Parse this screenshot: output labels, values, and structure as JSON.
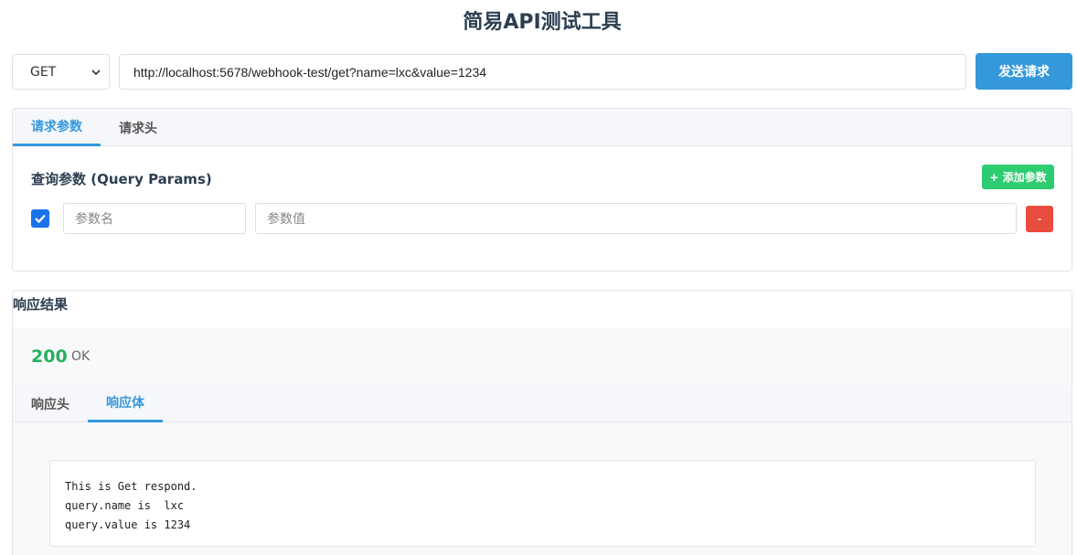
{
  "title": "简易API测试工具",
  "request": {
    "method": "GET",
    "url": "http://localhost:5678/webhook-test/get?name=lxc&value=1234",
    "send_label": "发送请求"
  },
  "request_tabs": [
    {
      "label": "请求参数",
      "active": true
    },
    {
      "label": "请求头",
      "active": false
    }
  ],
  "query_params": {
    "title": "查询参数 (Query Params)",
    "add_label": "+ 添加参数",
    "rows": [
      {
        "enabled": true,
        "name_placeholder": "参数名",
        "value_placeholder": "参数值",
        "remove_label": "-"
      }
    ]
  },
  "response": {
    "title": "响应结果",
    "status_code": "200",
    "status_text": "OK",
    "tabs": [
      {
        "label": "响应头",
        "active": false
      },
      {
        "label": "响应体",
        "active": true
      }
    ],
    "body_lines": [
      "This is Get respond.",
      "query.name is  lxc",
      "query.value is 1234"
    ]
  },
  "colors": {
    "primary": "#3498db",
    "success": "#2ecc71",
    "danger": "#e74c3c",
    "status_ok": "#27ae60"
  }
}
